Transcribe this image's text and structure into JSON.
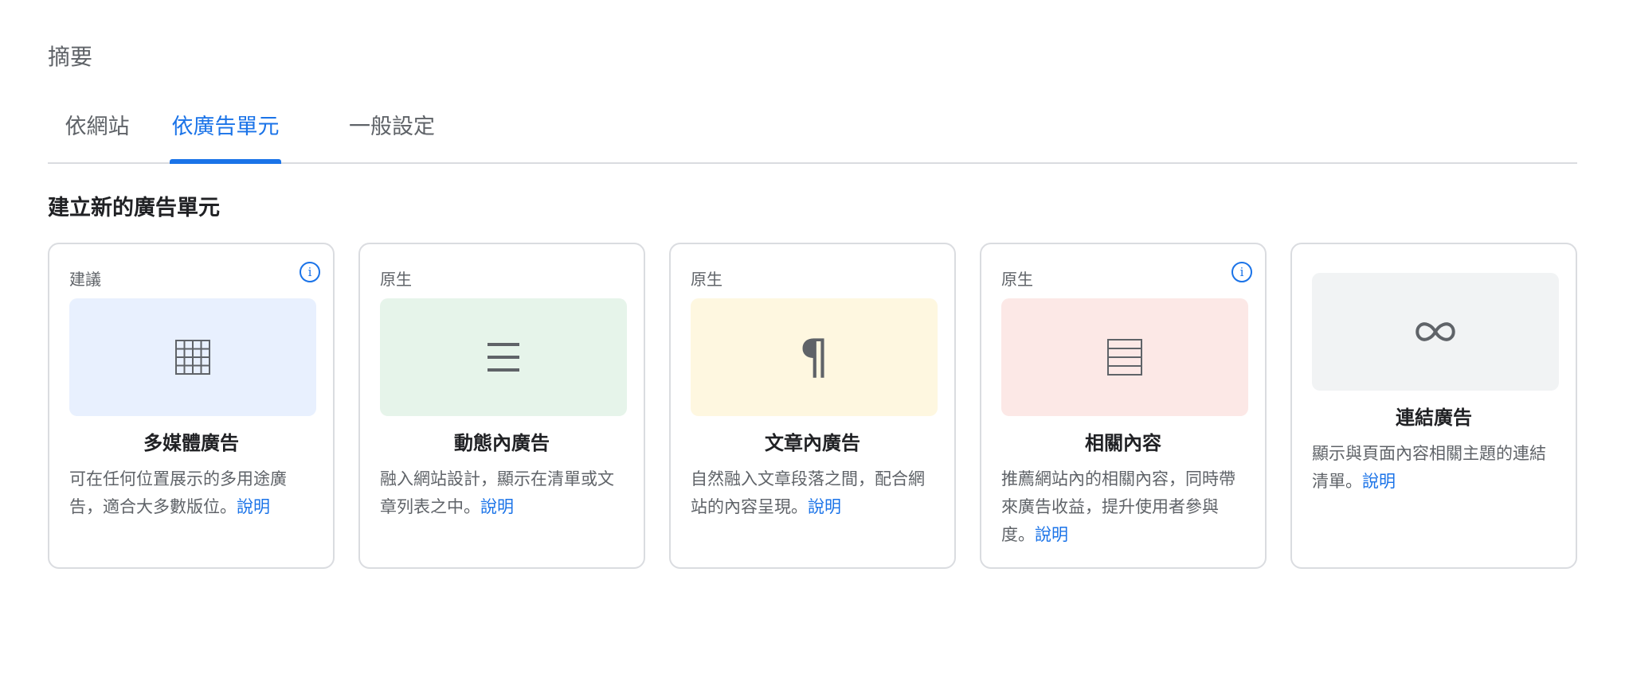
{
  "page": {
    "title": "摘要"
  },
  "tabs": [
    {
      "label": "依網站",
      "active": false
    },
    {
      "label": "依廣告單元",
      "active": true
    },
    {
      "label": "一般設定",
      "active": false
    }
  ],
  "section": {
    "heading": "建立新的廣告單元"
  },
  "cards": [
    {
      "tag": "建議",
      "has_info": true,
      "icon": "grid-icon",
      "thumb_color": "#e8f0fe",
      "title": "多媒體廣告",
      "description": "可在任何位置展示的多用途廣告，適合大多數版位。",
      "link": "說明"
    },
    {
      "tag": "原生",
      "has_info": false,
      "icon": "feed-lines-icon",
      "thumb_color": "#e6f4ea",
      "title": "動態內廣告",
      "description": "融入網站設計，顯示在清單或文章列表之中。",
      "link": "說明"
    },
    {
      "tag": "原生",
      "has_info": false,
      "icon": "paragraph-icon",
      "thumb_color": "#fef7e0",
      "title": "文章內廣告",
      "description": "自然融入文章段落之間，配合網站的內容呈現。",
      "link": "說明"
    },
    {
      "tag": "原生",
      "has_info": true,
      "icon": "list-box-icon",
      "thumb_color": "#fce8e6",
      "title": "相關內容",
      "description": "推薦網站內的相關內容，同時帶來廣告收益，提升使用者參與度。",
      "link": "說明"
    },
    {
      "tag": "",
      "has_info": false,
      "icon": "infinity-icon",
      "thumb_color": "#f1f3f4",
      "title": "連結廣告",
      "description": "顯示與頁面內容相關主題的連結清單。",
      "link": "說明"
    }
  ],
  "colors": {
    "accent": "#1a73e8",
    "border": "#dadce0",
    "muted_text": "#5f6368"
  }
}
